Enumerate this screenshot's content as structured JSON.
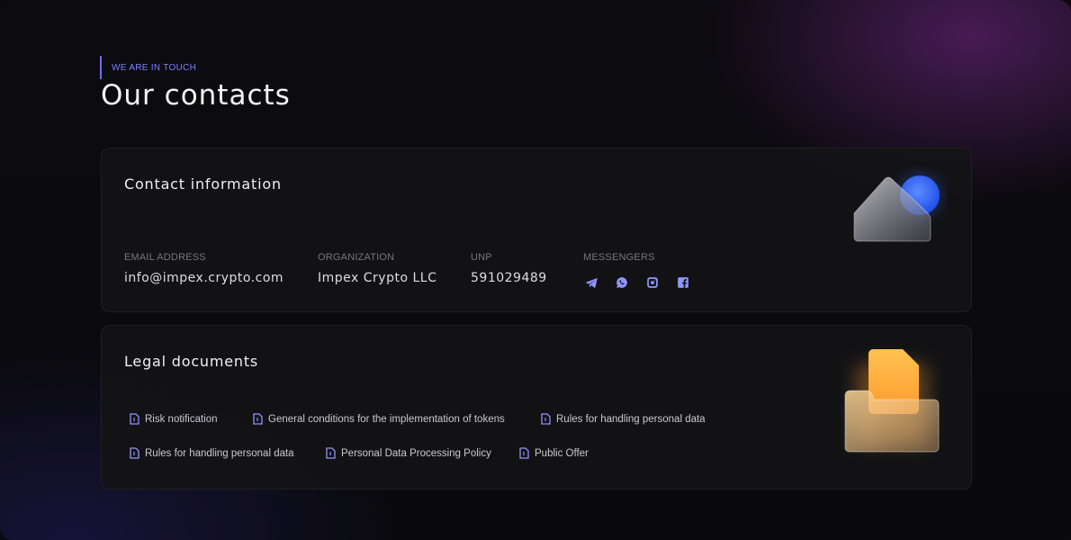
{
  "header": {
    "eyebrow": "WE ARE IN TOUCH",
    "title": "Our contacts"
  },
  "contact": {
    "title": "Contact information",
    "email": {
      "label": "EMAIL ADDRESS",
      "value": "info@impex.crypto.com"
    },
    "organization": {
      "label": "ORGANIZATION",
      "value": "Impex Crypto LLC"
    },
    "unp": {
      "label": "UNP",
      "value": "591029489"
    },
    "messengers": {
      "label": "MESSENGERS",
      "icons": [
        "telegram-icon",
        "whatsapp-icon",
        "instagram-icon",
        "facebook-icon"
      ]
    },
    "illustration": "cloud-sun-icon"
  },
  "legal": {
    "title": "Legal documents",
    "rows": [
      [
        "Risk notification",
        "General conditions for the implementation of tokens",
        "Rules for handling personal data"
      ],
      [
        "Rules for handling personal data",
        "Personal Data Processing Policy",
        "Public Offer"
      ]
    ],
    "doc_icon": "document-icon",
    "illustration": "folder-icon"
  },
  "colors": {
    "accent": "#7c82ff",
    "icon_accent": "#8f95ff",
    "background": "#0b0a0e",
    "card": "#141416",
    "folder_orange": "#ffb648",
    "sun_blue": "#2d6bff"
  }
}
